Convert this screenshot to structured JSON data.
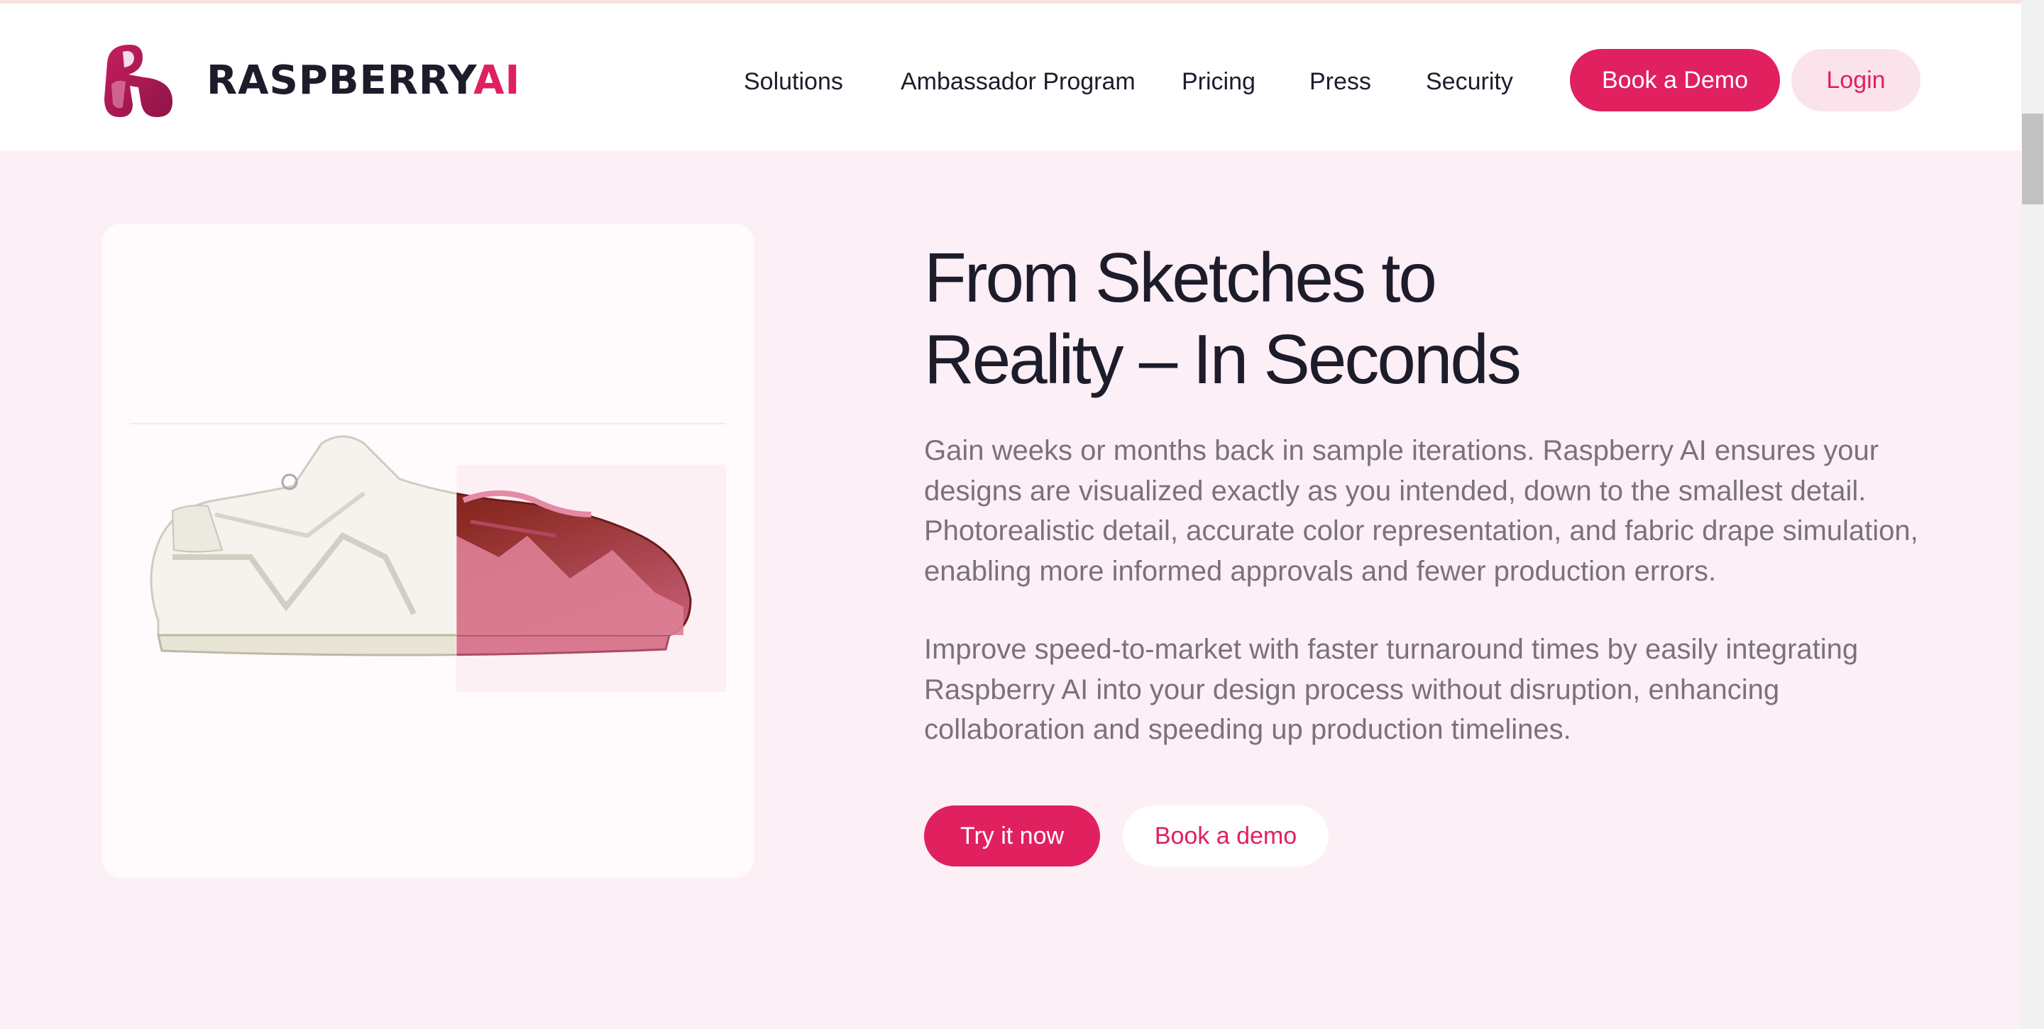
{
  "brand": {
    "name_main": "RASPBERRY",
    "name_accent": "AI"
  },
  "nav": {
    "items": [
      {
        "label": "Solutions"
      },
      {
        "label": "Ambassador Program"
      },
      {
        "label": "Pricing"
      },
      {
        "label": "Press"
      },
      {
        "label": "Security"
      }
    ],
    "book_demo_label": "Book a Demo",
    "login_label": "Login"
  },
  "hero": {
    "headline_line1": "From Sketches to",
    "headline_line2": "Reality – In Seconds",
    "paragraph1": "Gain weeks or months back in sample iterations. Raspberry AI ensures your designs are visualized exactly as you intended, down to the smallest detail. Photorealistic detail, accurate color representation, and fabric drape simulation, enabling more informed approvals and fewer production errors.",
    "paragraph2": "Improve speed-to-market with faster turnaround times by easily integrating Raspberry AI into your design process without disruption, enhancing collaboration and speeding up production timelines.",
    "try_label": "Try it now",
    "demo_label": "Book a demo",
    "image_icon": "sneaker-sketch-to-render-image"
  },
  "colors": {
    "accent": "#e0205f",
    "background": "#fdeff6",
    "text_dark": "#1d1c2b",
    "text_muted": "#7a727a"
  }
}
